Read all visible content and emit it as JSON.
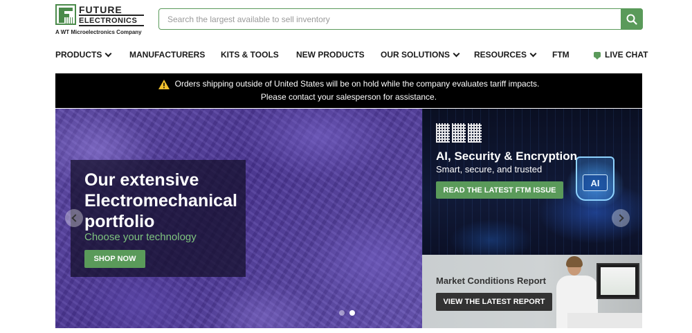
{
  "brand": {
    "line1": "FUTURE",
    "line2": "ELECTRONICS",
    "tagline": "A WT Microelectronics Company",
    "accent": "#5a9a5a"
  },
  "search": {
    "placeholder": "Search the largest available to sell inventory",
    "value": ""
  },
  "nav": {
    "items": [
      {
        "label": "PRODUCTS",
        "dropdown": true
      },
      {
        "label": "MANUFACTURERS",
        "dropdown": false
      },
      {
        "label": "KITS & TOOLS",
        "dropdown": false
      },
      {
        "label": "NEW PRODUCTS",
        "dropdown": false
      },
      {
        "label": "OUR SOLUTIONS",
        "dropdown": true
      },
      {
        "label": "RESOURCES",
        "dropdown": true
      },
      {
        "label": "FTM",
        "dropdown": false
      },
      {
        "label": "LIVE CHAT",
        "dropdown": false,
        "icon": "chat-icon"
      }
    ]
  },
  "alert": {
    "icon": "warning-icon",
    "line1": "Orders shipping outside of United States will be on hold while the company evaluates tariff impacts.",
    "line2": "Please contact your salesperson for assistance."
  },
  "hero": {
    "title": "Our extensive Electromechanical portfolio",
    "subtitle": "Choose your technology",
    "button": "SHOP NOW",
    "slides_total": 2,
    "active_slide": 2
  },
  "ftm": {
    "logo_text": "FTM",
    "title": "AI, Security & Encryption",
    "subtitle": "Smart, secure, and trusted",
    "button": "READ THE LATEST FTM ISSUE",
    "chip_label": "AI"
  },
  "market": {
    "title": "Market Conditions Report",
    "button": "VIEW THE LATEST REPORT"
  }
}
